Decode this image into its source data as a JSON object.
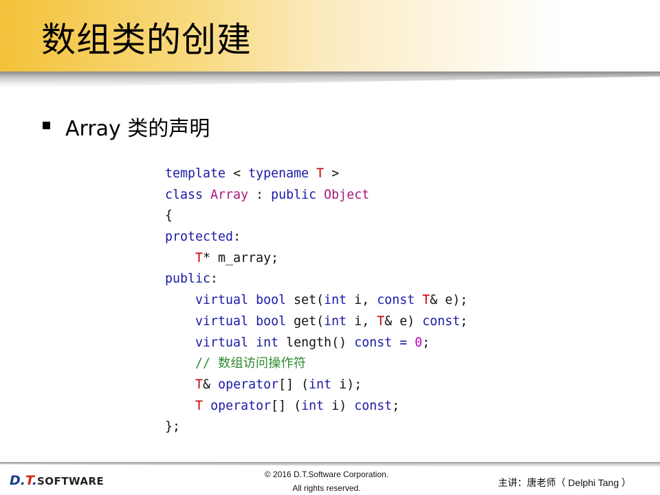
{
  "slide": {
    "title": "数组类的创建",
    "bullet": "Array 类的声明"
  },
  "code_lines": [
    [
      {
        "t": "template",
        "c": "kw"
      },
      {
        "t": " < ",
        "c": ""
      },
      {
        "t": "typename",
        "c": "kw"
      },
      {
        "t": " ",
        "c": ""
      },
      {
        "t": "T",
        "c": "tp"
      },
      {
        "t": " >",
        "c": ""
      }
    ],
    [
      {
        "t": "class",
        "c": "kw"
      },
      {
        "t": " ",
        "c": ""
      },
      {
        "t": "Array",
        "c": "cls"
      },
      {
        "t": " : ",
        "c": ""
      },
      {
        "t": "public",
        "c": "kw"
      },
      {
        "t": " ",
        "c": ""
      },
      {
        "t": "Object",
        "c": "cls"
      }
    ],
    [
      {
        "t": "{",
        "c": ""
      }
    ],
    [
      {
        "t": "protected",
        "c": "kw"
      },
      {
        "t": ":",
        "c": ""
      }
    ],
    [
      {
        "t": "    ",
        "c": ""
      },
      {
        "t": "T",
        "c": "tp"
      },
      {
        "t": "* m_array;",
        "c": ""
      }
    ],
    [
      {
        "t": "public",
        "c": "kw"
      },
      {
        "t": ":",
        "c": ""
      }
    ],
    [
      {
        "t": "    ",
        "c": ""
      },
      {
        "t": "virtual",
        "c": "kw"
      },
      {
        "t": " ",
        "c": ""
      },
      {
        "t": "bool",
        "c": "kw"
      },
      {
        "t": " set(",
        "c": ""
      },
      {
        "t": "int",
        "c": "kw"
      },
      {
        "t": " i, ",
        "c": ""
      },
      {
        "t": "const",
        "c": "kw"
      },
      {
        "t": " ",
        "c": ""
      },
      {
        "t": "T",
        "c": "tp"
      },
      {
        "t": "& e);",
        "c": ""
      }
    ],
    [
      {
        "t": "    ",
        "c": ""
      },
      {
        "t": "virtual",
        "c": "kw"
      },
      {
        "t": " ",
        "c": ""
      },
      {
        "t": "bool",
        "c": "kw"
      },
      {
        "t": " get(",
        "c": ""
      },
      {
        "t": "int",
        "c": "kw"
      },
      {
        "t": " i, ",
        "c": ""
      },
      {
        "t": "T",
        "c": "tp"
      },
      {
        "t": "& e) ",
        "c": ""
      },
      {
        "t": "const",
        "c": "kw"
      },
      {
        "t": ";",
        "c": ""
      }
    ],
    [
      {
        "t": "    ",
        "c": ""
      },
      {
        "t": "virtual",
        "c": "kw"
      },
      {
        "t": " ",
        "c": ""
      },
      {
        "t": "int",
        "c": "kw"
      },
      {
        "t": " length() ",
        "c": ""
      },
      {
        "t": "const",
        "c": "kw"
      },
      {
        "t": " ",
        "c": ""
      },
      {
        "t": "=",
        "c": "kw"
      },
      {
        "t": " ",
        "c": ""
      },
      {
        "t": "0",
        "c": "num"
      },
      {
        "t": ";",
        "c": ""
      }
    ],
    [
      {
        "t": "    ",
        "c": ""
      },
      {
        "t": "// 数组访问操作符",
        "c": "cm"
      }
    ],
    [
      {
        "t": "    ",
        "c": ""
      },
      {
        "t": "T",
        "c": "tp"
      },
      {
        "t": "& ",
        "c": ""
      },
      {
        "t": "operator",
        "c": "kw"
      },
      {
        "t": "[] (",
        "c": ""
      },
      {
        "t": "int",
        "c": "kw"
      },
      {
        "t": " i);",
        "c": ""
      }
    ],
    [
      {
        "t": "    ",
        "c": ""
      },
      {
        "t": "T",
        "c": "tp"
      },
      {
        "t": " ",
        "c": ""
      },
      {
        "t": "operator",
        "c": "kw"
      },
      {
        "t": "[] (",
        "c": ""
      },
      {
        "t": "int",
        "c": "kw"
      },
      {
        "t": " i) ",
        "c": ""
      },
      {
        "t": "const",
        "c": "kw"
      },
      {
        "t": ";",
        "c": ""
      }
    ],
    [
      {
        "t": "};",
        "c": ""
      }
    ]
  ],
  "footer": {
    "logo_prefix": "D.",
    "logo_t": "T",
    "logo_dot": ".",
    "logo_software": "SOFTWARE",
    "copyright_line1": "© 2016 D.T.Software Corporation.",
    "copyright_line2": "All rights reserved.",
    "lecturer": "主讲：唐老师（ Delphi Tang ）"
  },
  "colors": {
    "keyword": "#1a1aa6",
    "type_param": "#c80000",
    "class_name": "#a8177d",
    "comment": "#2e8b2e",
    "number": "#c000c0",
    "title_gold": "#f3c23a"
  }
}
